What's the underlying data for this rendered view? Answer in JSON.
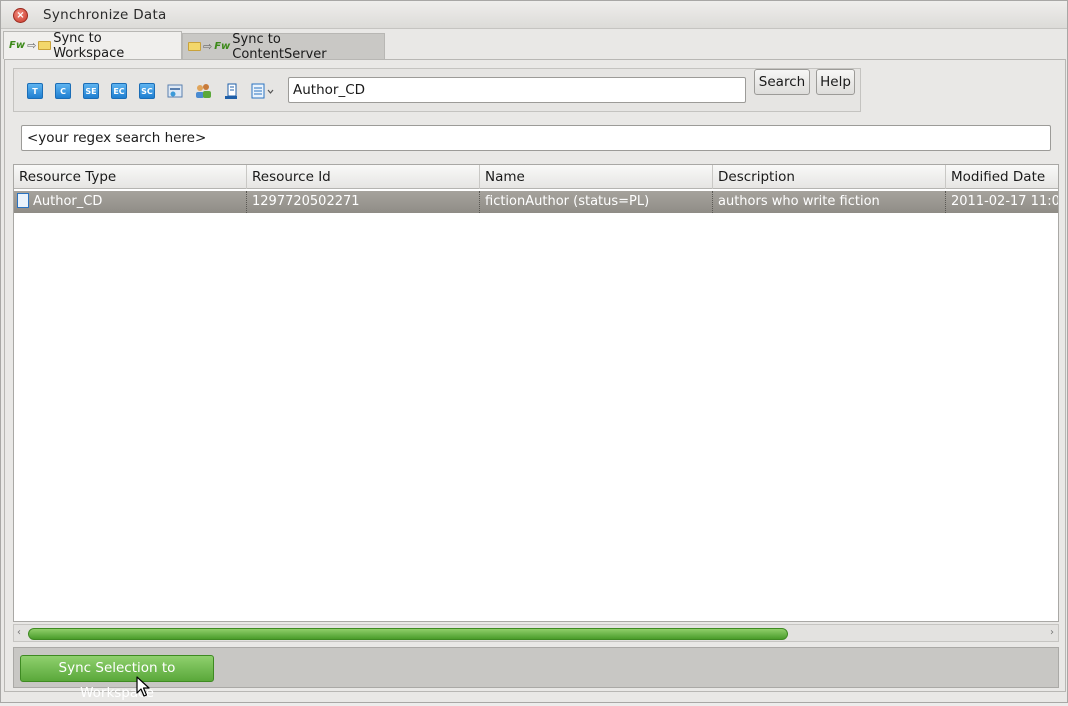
{
  "window": {
    "title": "Synchronize Data"
  },
  "tabs": [
    {
      "label": "Sync to Workspace",
      "active": true
    },
    {
      "label": "Sync to ContentServer",
      "active": false
    }
  ],
  "toolbar": {
    "type_buttons": [
      "T",
      "C",
      "SE",
      "EC",
      "SC"
    ],
    "search_value": "Author_CD",
    "search_button": "Search",
    "help_button": "Help"
  },
  "regex": {
    "placeholder": "<your regex search here>"
  },
  "table": {
    "columns": [
      "Resource Type",
      "Resource Id",
      "Name",
      "Description",
      "Modified Date"
    ],
    "rows": [
      {
        "resource_type": "Author_CD",
        "resource_id": "1297720502271",
        "name": "fictionAuthor (status=PL)",
        "description": "authors who write fiction",
        "modified_date": "2011-02-17 11:0"
      }
    ]
  },
  "footer": {
    "sync_button": "Sync Selection to Workspace"
  },
  "colors": {
    "accent_green": "#5aa83a",
    "selection_row": "#9a9791"
  }
}
